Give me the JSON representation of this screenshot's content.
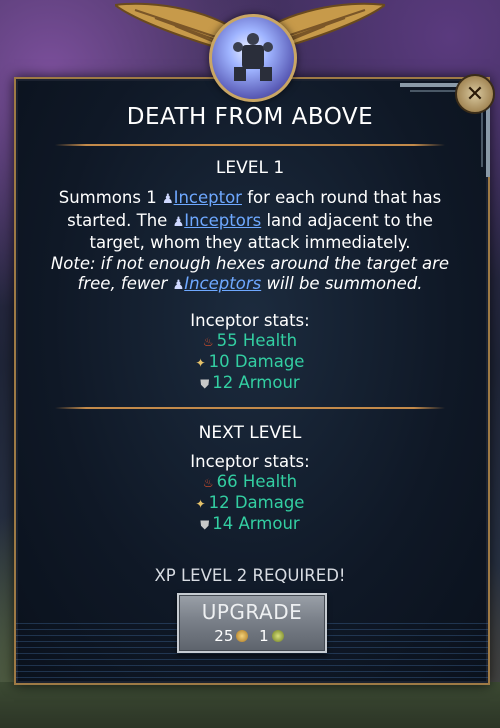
{
  "dialog": {
    "title": "DEATH FROM ABOVE",
    "close_label": "✕"
  },
  "level": {
    "heading": "LEVEL 1",
    "desc_part1": "Summons 1",
    "unit_link_1": "Inceptor",
    "desc_part2": "for each round that has started. The",
    "unit_link_2": "Inceptors",
    "desc_part3": "land adjacent to the target, whom they attack immediately.",
    "note_part1": "Note: if not enough hexes around the target are free, fewer",
    "unit_link_3": "Inceptors",
    "note_part2": "will be summoned.",
    "stats_label": "Inceptor stats:",
    "health": "55 Health",
    "damage": "10 Damage",
    "armour": "12 Armour"
  },
  "next_level": {
    "heading": "NEXT LEVEL",
    "stats_label": "Inceptor stats:",
    "health": "66 Health",
    "damage": "12 Damage",
    "armour": "14 Armour"
  },
  "upgrade": {
    "requirement": "XP LEVEL 2 REQUIRED!",
    "button_label": "UPGRADE",
    "cost_gold": "25",
    "cost_other": "1"
  },
  "colors": {
    "stat_text": "#33cfa2",
    "link": "#6ea8ff",
    "border_gold": "#9e7a45"
  }
}
